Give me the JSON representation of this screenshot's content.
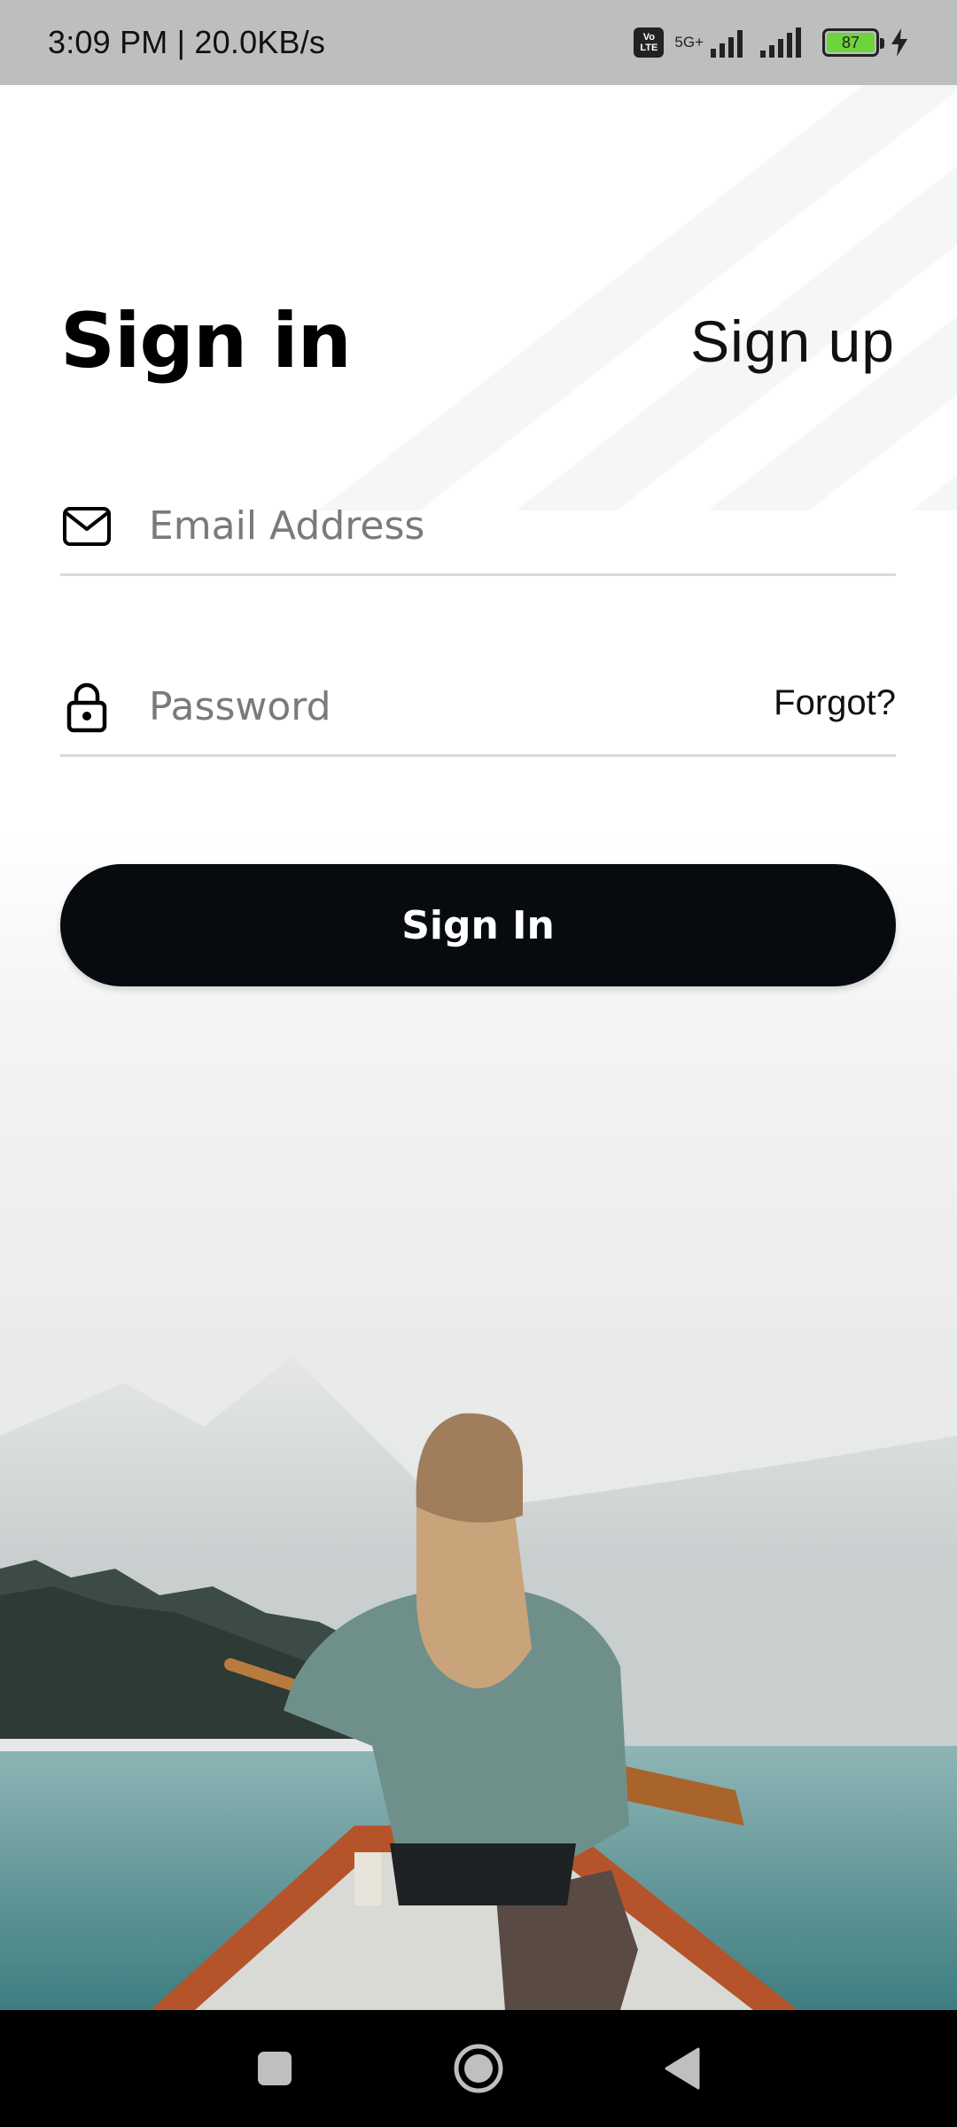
{
  "status_bar": {
    "time_speed": "3:09 PM | 20.0KB/s",
    "volte_label": "Vo LTE",
    "network_label": "5G+",
    "battery_level": "87",
    "icons": [
      "volte-icon",
      "signal-icon",
      "signal-icon",
      "battery-icon",
      "charging-icon"
    ]
  },
  "header": {
    "signin_title": "Sign in",
    "signup_link": "Sign up"
  },
  "form": {
    "email": {
      "icon": "mail-icon",
      "placeholder": "Email Address",
      "value": ""
    },
    "password": {
      "icon": "lock-icon",
      "placeholder": "Password",
      "value": "",
      "forgot_label": "Forgot?"
    },
    "submit_label": "Sign In"
  },
  "nav": {
    "icons": [
      "recents-square-icon",
      "home-circle-icon",
      "back-triangle-icon"
    ]
  },
  "colors": {
    "button_bg": "#070b10",
    "status_bar_bg": "#bdbebe",
    "battery_fill": "#6fd43c",
    "underline": "#dadada",
    "placeholder": "#7a7a7a"
  }
}
